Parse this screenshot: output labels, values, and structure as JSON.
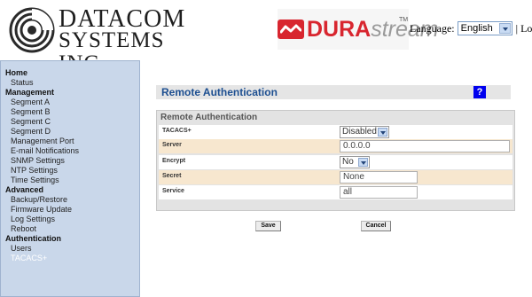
{
  "header": {
    "brand_line1": "DATACOM",
    "brand_line2": "SYSTEMS INC",
    "product_part1": "DURA",
    "product_part2": "stream",
    "product_tm": "TM",
    "language_label": "Language:",
    "language_value": "English",
    "separator": "|",
    "logout_label": "Logout"
  },
  "sidebar": {
    "items": [
      {
        "label": "Home",
        "kind": "group"
      },
      {
        "label": "Status",
        "kind": "item"
      },
      {
        "label": "Management",
        "kind": "group"
      },
      {
        "label": "Segment A",
        "kind": "item"
      },
      {
        "label": "Segment B",
        "kind": "item"
      },
      {
        "label": "Segment C",
        "kind": "item"
      },
      {
        "label": "Segment D",
        "kind": "item"
      },
      {
        "label": "Management Port",
        "kind": "item"
      },
      {
        "label": "E-mail Notifications",
        "kind": "item"
      },
      {
        "label": "SNMP Settings",
        "kind": "item"
      },
      {
        "label": "NTP Settings",
        "kind": "item"
      },
      {
        "label": "Time Settings",
        "kind": "item"
      },
      {
        "label": "Advanced",
        "kind": "group"
      },
      {
        "label": "Backup/Restore",
        "kind": "item"
      },
      {
        "label": "Firmware Update",
        "kind": "item"
      },
      {
        "label": "Log Settings",
        "kind": "item"
      },
      {
        "label": "Reboot",
        "kind": "item"
      },
      {
        "label": "Authentication",
        "kind": "group"
      },
      {
        "label": "Users",
        "kind": "item"
      },
      {
        "label": "TACACS+",
        "kind": "item",
        "active": true
      }
    ]
  },
  "main": {
    "page_title": "Remote Authentication",
    "help_label": "?",
    "panel_title": "Remote Authentication",
    "rows": {
      "tacacs": {
        "label": "TACACS+",
        "value": "Disabled"
      },
      "server": {
        "label": "Server",
        "value": "0.0.0.0"
      },
      "encrypt": {
        "label": "Encrypt",
        "value": "No"
      },
      "secret": {
        "label": "Secret",
        "value": "None"
      },
      "service": {
        "label": "Service",
        "value": "all"
      }
    },
    "save_label": "Save",
    "cancel_label": "Cancel"
  },
  "colors": {
    "sidebar_bg": "#c9d7ea",
    "title_blue": "#1d4f91",
    "row_beige": "#f7e7cf",
    "dura_red": "#d8262f"
  }
}
